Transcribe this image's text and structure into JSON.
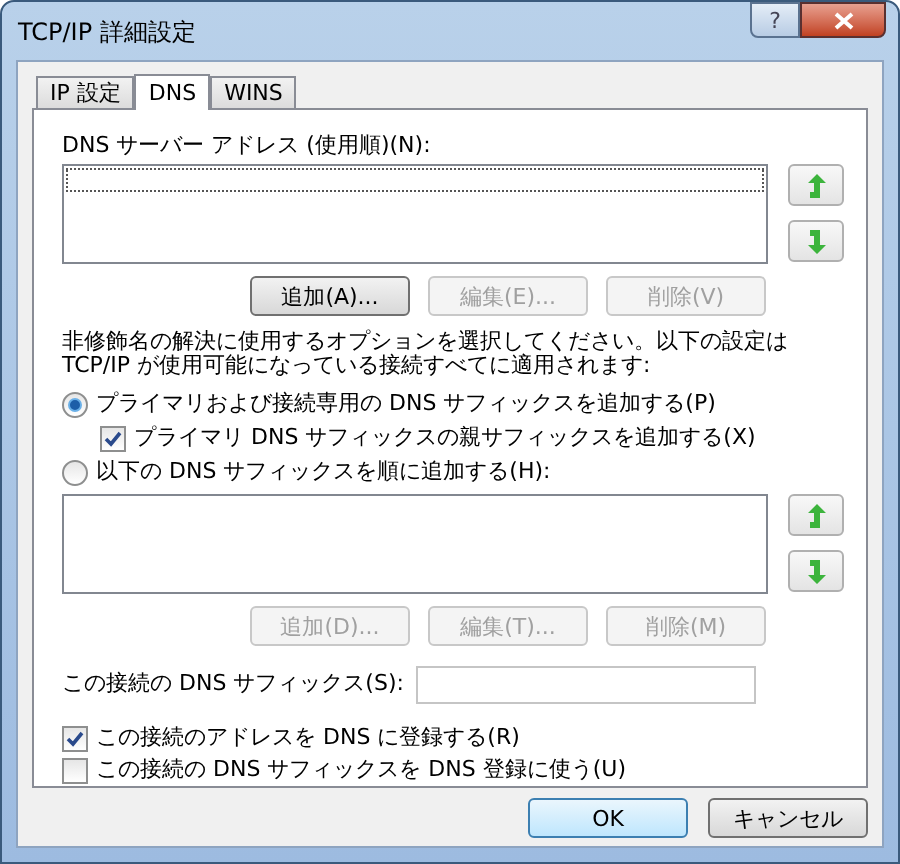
{
  "window": {
    "title": "TCP/IP 詳細設定",
    "help_button": "?"
  },
  "tabs": [
    {
      "label": "IP 設定",
      "selected": false
    },
    {
      "label": "DNS",
      "selected": true
    },
    {
      "label": "WINS",
      "selected": false
    }
  ],
  "dns_servers": {
    "label": "DNS サーバー アドレス (使用順)(N):",
    "buttons": [
      {
        "label": "追加(A)...",
        "disabled": false
      },
      {
        "label": "編集(E)...",
        "disabled": true
      },
      {
        "label": "削除(V)",
        "disabled": true
      }
    ]
  },
  "description": "非修飾名の解決に使用するオプションを選択してください。以下の設定は TCP/IP が使用可能になっている接続すべてに適用されます:",
  "resolution_options": [
    {
      "kind": "radio",
      "label": "プライマリおよび接続専用の DNS サフィックスを追加する(P)",
      "selected": true,
      "children": [
        {
          "kind": "checkbox",
          "label": "プライマリ DNS サフィックスの親サフィックスを追加する(X)",
          "checked": true
        }
      ]
    },
    {
      "kind": "radio",
      "label": "以下の DNS サフィックスを順に追加する(H):",
      "selected": false
    }
  ],
  "suffix_list": {
    "buttons": [
      {
        "label": "追加(D)...",
        "disabled": true
      },
      {
        "label": "編集(T)...",
        "disabled": true
      },
      {
        "label": "削除(M)",
        "disabled": true
      }
    ]
  },
  "connection_suffix": {
    "label": "この接続の DNS サフィックス(S):"
  },
  "registration": [
    {
      "label": "この接続のアドレスを DNS に登録する(R)",
      "checked": true
    },
    {
      "label": "この接続の DNS サフィックスを DNS 登録に使う(U)",
      "checked": false
    }
  ],
  "dialog_buttons": [
    {
      "label": "OK",
      "default": true
    },
    {
      "label": "キャンセル",
      "default": false
    }
  ]
}
